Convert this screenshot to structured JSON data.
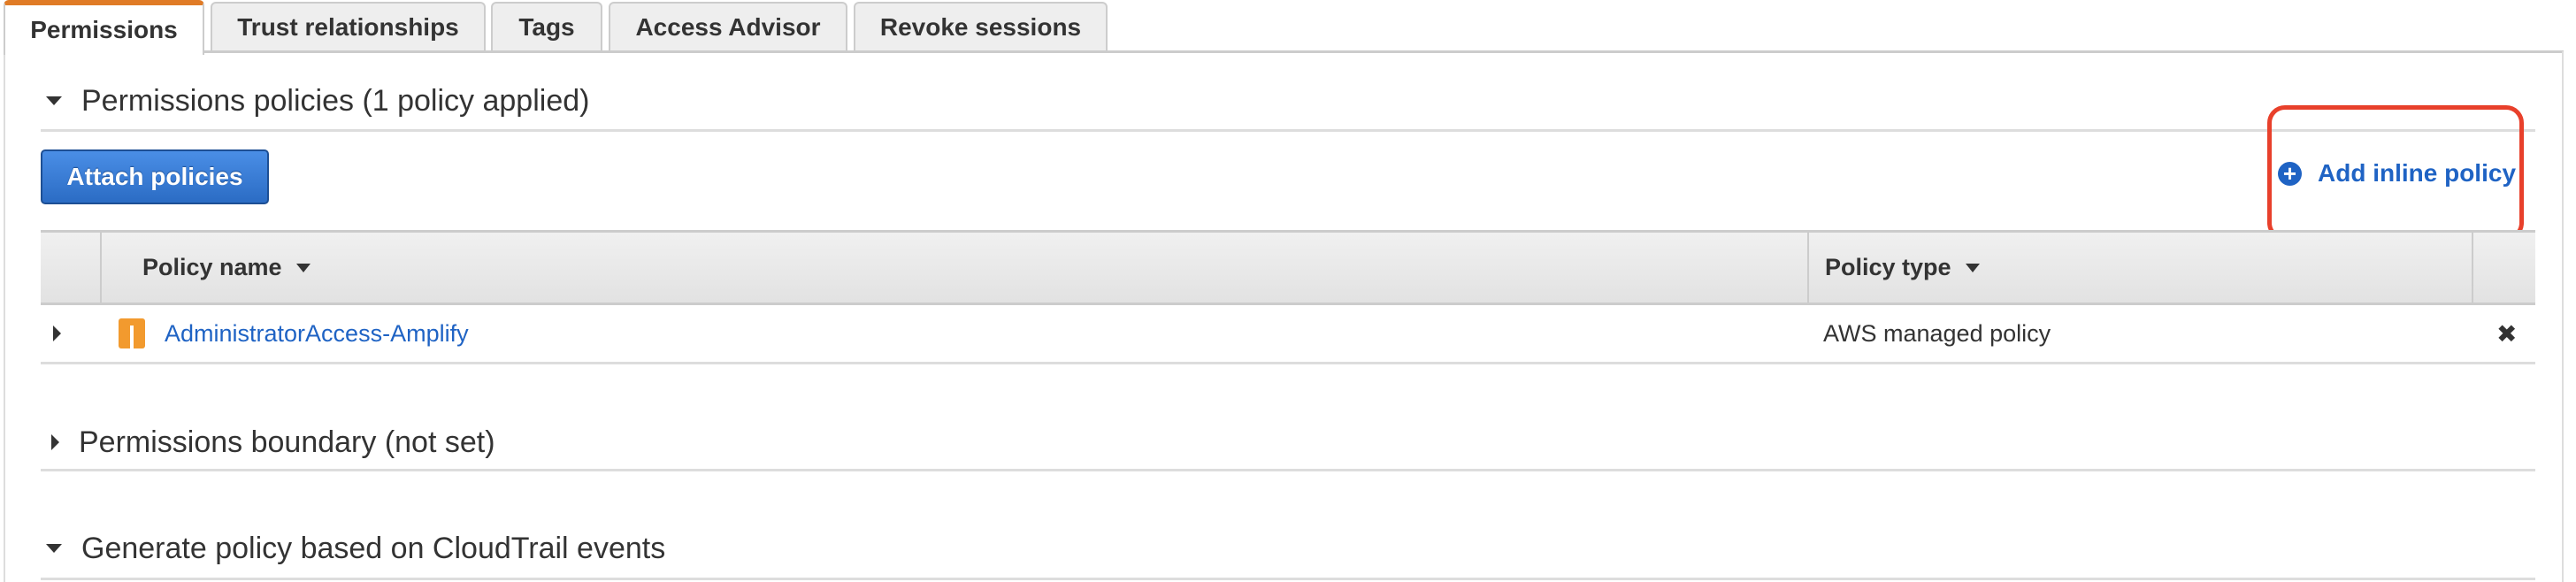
{
  "tabs": [
    {
      "label": "Permissions",
      "active": true
    },
    {
      "label": "Trust relationships"
    },
    {
      "label": "Tags"
    },
    {
      "label": "Access Advisor"
    },
    {
      "label": "Revoke sessions"
    }
  ],
  "permissions_policies": {
    "title": "Permissions policies (1 policy applied)",
    "attach_label": "Attach policies",
    "add_inline_label": "Add inline policy",
    "columns": [
      "Policy name",
      "Policy type"
    ],
    "rows": [
      {
        "name": "AdministratorAccess-Amplify",
        "type": "AWS managed policy",
        "remove": "✖"
      }
    ]
  },
  "boundary": {
    "title": "Permissions boundary (not set)"
  },
  "generate": {
    "title": "Generate policy based on CloudTrail events"
  },
  "colors": {
    "accent": "#e07b26",
    "link": "#1f63c4",
    "highlight": "#e8402b"
  }
}
